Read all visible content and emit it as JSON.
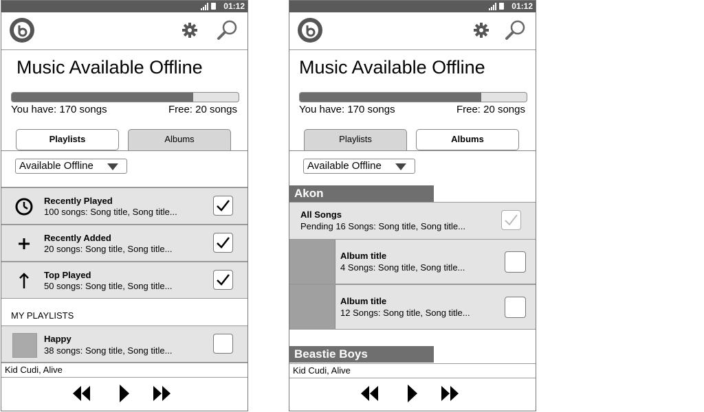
{
  "status": {
    "time": "01:12"
  },
  "screens": [
    {
      "title": "Music Available Offline",
      "progress": 0.8,
      "have": "You have: 170 songs",
      "free": "Free: 20 songs",
      "tabs": {
        "playlists": "Playlists",
        "albums": "Albums",
        "active": "playlists"
      },
      "filter": "Available Offline",
      "items": [
        {
          "title": "Recently Played",
          "subtitle": "100 songs: Song title, Song title...",
          "icon": "clock-icon",
          "checked": true
        },
        {
          "title": "Recently Added",
          "subtitle": "20 songs: Song title, Song title...",
          "icon": "plus-icon",
          "checked": true
        },
        {
          "title": "Top Played",
          "subtitle": "50 songs: Song title, Song title...",
          "icon": "arrow-up-icon",
          "checked": true
        }
      ],
      "section_label": "MY PLAYLISTS",
      "playlists": [
        {
          "title": "Happy",
          "subtitle": "38 songs: Song title, Song title...",
          "checked": false
        }
      ],
      "now_playing": "Kid Cudi, Alive"
    },
    {
      "title": "Music Available Offline",
      "progress": 0.8,
      "have": "You have: 170 songs",
      "free": "Free: 20 songs",
      "tabs": {
        "playlists": "Playlists",
        "albums": "Albums",
        "active": "albums"
      },
      "filter": "Available Offline",
      "artists": [
        {
          "name": "Akon",
          "all_songs": {
            "title": "All Songs",
            "subtitle": "Pending 16 Songs: Song title, Song title...",
            "state": "pending"
          },
          "albums": [
            {
              "title": "Album title",
              "subtitle": "4 Songs: Song title, Song title...",
              "checked": false
            },
            {
              "title": "Album title",
              "subtitle": "12 Songs: Song title, Song title...",
              "checked": false
            }
          ]
        },
        {
          "name": "Beastie Boys"
        }
      ],
      "now_playing": "Kid Cudi, Alive"
    }
  ]
}
